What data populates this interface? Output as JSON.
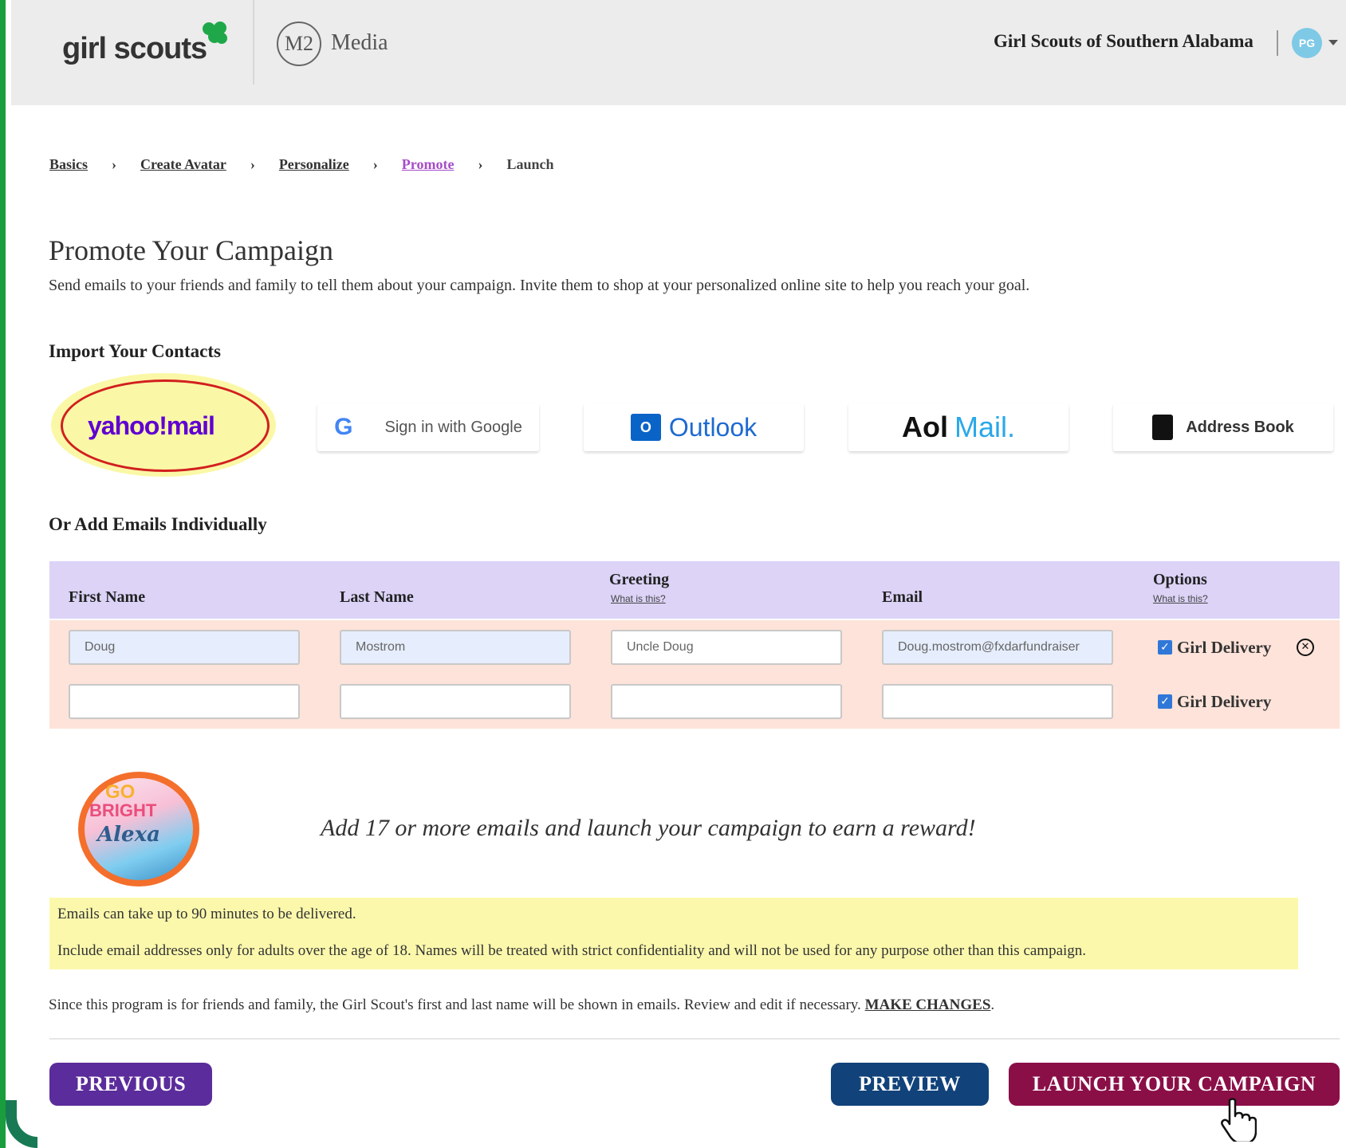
{
  "header": {
    "logo": "girl scouts",
    "partner_initials": "M2",
    "partner_name": "Media",
    "council_name": "Girl Scouts of Southern Alabama",
    "avatar_initials": "PG"
  },
  "breadcrumb": {
    "items": [
      {
        "label": "Basics"
      },
      {
        "label": "Create Avatar"
      },
      {
        "label": "Personalize"
      },
      {
        "label": "Promote"
      },
      {
        "label": "Launch"
      }
    ],
    "separator": "›"
  },
  "page": {
    "title": "Promote Your Campaign",
    "subtitle": "Send emails to your friends and family to tell them about your campaign. Invite them to shop at your personalized online site to help you reach your goal."
  },
  "import": {
    "heading": "Import Your Contacts",
    "yahoo": "yahoo!mail",
    "google": "Sign in with Google",
    "google_glyph": "G",
    "outlook": "Outlook",
    "outlook_glyph": "O",
    "aol_brand": "Aol",
    "aol_mail": "Mail.",
    "address_book": "Address Book"
  },
  "individual": {
    "heading": "Or Add Emails Individually",
    "columns": {
      "first_name": "First Name",
      "last_name": "Last Name",
      "greeting": "Greeting",
      "greeting_help": "What is this?",
      "email": "Email",
      "options": "Options",
      "options_help": "What is this?"
    },
    "rows": [
      {
        "first_name": "Doug",
        "last_name": "Mostrom",
        "greeting": "Uncle Doug",
        "email": "Doug.mostrom@fxdarfundraiser",
        "option_label": "Girl Delivery",
        "checked": true
      },
      {
        "first_name": "",
        "last_name": "",
        "greeting": "",
        "email": "",
        "option_label": "Girl Delivery",
        "checked": true
      }
    ],
    "check_glyph": "✓",
    "remove_glyph": "✕"
  },
  "reward": {
    "badge_go": "GO",
    "badge_bright": "BRIGHT",
    "badge_name": "Alexa",
    "text": "Add 17 or more emails and launch your campaign to earn a reward!"
  },
  "notice": {
    "line1": "Emails can take up to 90 minutes to be delivered.",
    "line2": "Include email addresses only for adults over the age of 18. Names will be treated with strict confidentiality and will not be used for any purpose other than this campaign."
  },
  "footer": {
    "note": "Since this program is for friends and family, the Girl Scout's first and last name will be shown in emails. Review and edit if necessary.",
    "make_changes": "MAKE CHANGES",
    "note_end": "."
  },
  "buttons": {
    "previous": "PREVIOUS",
    "preview": "PREVIEW",
    "launch": "LAUNCH YOUR CAMPAIGN"
  },
  "colors": {
    "brand_green": "#1a9d3c",
    "active_crumb": "#a64cc9",
    "table_header": "#dcd3f7",
    "table_row": "#fde3d9",
    "notice_bg": "#fbf8ac",
    "previous_btn": "#5b2c9b",
    "preview_btn": "#11427a",
    "launch_btn": "#8a0f47",
    "highlight_ring": "#d21f1f"
  },
  "icons": [
    "clover-icon",
    "avatar-icon",
    "chevron-down-icon",
    "google-icon",
    "outlook-icon",
    "address-book-icon",
    "checkbox-icon",
    "remove-icon",
    "hand-cursor-icon"
  ]
}
